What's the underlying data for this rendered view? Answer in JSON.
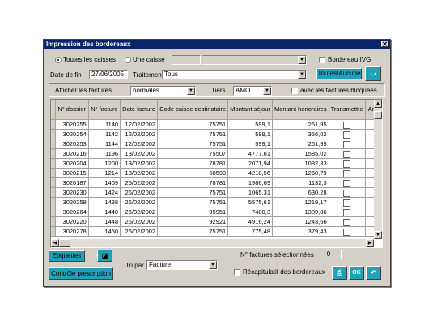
{
  "window": {
    "title": "Impression des bordereaux",
    "close_glyph": "✕"
  },
  "filters": {
    "radio_all_label": "Toutes les caisses",
    "radio_one_label": "Une caisse",
    "caisse_code": "",
    "caisse_name": "",
    "bordereau_ivg_label": "Bordereau IVG",
    "date_fin_label": "Date de fin",
    "date_fin_value": "27/06/2005",
    "traitement_label": "Traitement",
    "traitement_value": "Tous",
    "toutes_aucune_label": "Toutes/Aucune",
    "afficher_label": "Afficher les factures",
    "afficher_value": "normales",
    "tiers_label": "Tiers",
    "tiers_value": "AMO",
    "bloquees_label": "avec les factures bloquées"
  },
  "grid": {
    "columns": [
      "",
      "N° dossier",
      "N° facture",
      "Date facture",
      "Code caisse destinataire",
      "Montant séjour",
      "Montant honoraires",
      "Transmettre",
      "Ano"
    ],
    "rows": [
      [
        "3020255",
        "1140",
        "12/02/2002",
        "75751",
        "599,1",
        "261,95"
      ],
      [
        "3020254",
        "1142",
        "12/02/2002",
        "75751",
        "599,1",
        "356,02"
      ],
      [
        "3020253",
        "1144",
        "12/02/2002",
        "75751",
        "599,1",
        "261,95"
      ],
      [
        "3020216",
        "1196",
        "13/02/2002",
        "75507",
        "4777,61",
        "1585,02"
      ],
      [
        "3020204",
        "1200",
        "13/02/2002",
        "78781",
        "2071,94",
        "1082,33"
      ],
      [
        "3020215",
        "1214",
        "13/02/2002",
        "60599",
        "4218,56",
        "1260,79"
      ],
      [
        "3020187",
        "1409",
        "26/02/2002",
        "78781",
        "1986,69",
        "1132,3"
      ],
      [
        "3020230",
        "1424",
        "26/02/2002",
        "75751",
        "1065,31",
        "630,28"
      ],
      [
        "3020259",
        "1438",
        "26/02/2002",
        "75751",
        "5575,61",
        "1219,17"
      ],
      [
        "3020264",
        "1440",
        "26/02/2002",
        "95951",
        "7480,3",
        "1389,86"
      ],
      [
        "3020220",
        "1448",
        "26/02/2002",
        "92921",
        "4916,24",
        "1243,66"
      ],
      [
        "3020278",
        "1450",
        "26/02/2002",
        "75751",
        "775,48",
        "379,43"
      ]
    ]
  },
  "footer": {
    "etiquettes_label": "Etiquettes",
    "controle_label": "Contrôle prescription",
    "tri_label": "Tri par",
    "tri_value": "Facture",
    "nb_selected_label": "N° factures sélectionnées :",
    "nb_selected_value": "0",
    "recap_label": "Récapitulatif des bordereaux",
    "ok_label": "OK"
  },
  "colors": {
    "title_bar": "#0a246a",
    "accent_button": "#21a0b8",
    "dialog_bg": "#d4d0c8"
  }
}
